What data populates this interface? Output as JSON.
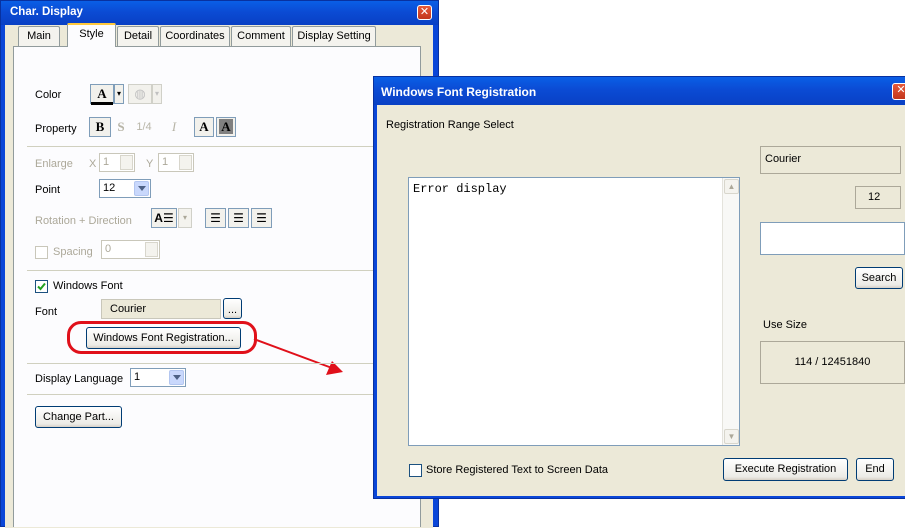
{
  "char_display": {
    "title": "Char. Display",
    "tabs": [
      "Main",
      "Style",
      "Detail",
      "Coordinates",
      "Comment",
      "Display Setting"
    ],
    "selected_tab": "Style",
    "color_label": "Color",
    "color_glyph": "A",
    "property_label": "Property",
    "property_buttons": [
      "B",
      "S",
      "1/4",
      "I",
      "A",
      "A"
    ],
    "enlarge_label": "Enlarge",
    "enlarge_x_label": "X",
    "enlarge_x_value": "1",
    "enlarge_y_label": "Y",
    "enlarge_y_value": "1",
    "point_label": "Point",
    "point_value": "12",
    "rotation_label": "Rotation + Direction",
    "spacing_label": "Spacing",
    "spacing_value": "0",
    "windows_font_label": "Windows Font",
    "windows_font_checked": true,
    "font_label": "Font",
    "font_value": "Courier",
    "browse_label": "...",
    "registration_button": "Windows Font Registration...",
    "display_language_label": "Display Language",
    "display_language_value": "1",
    "change_part_button": "Change Part..."
  },
  "font_registration": {
    "title": "Windows Font Registration",
    "range_label": "Registration Range Select",
    "text_content": "Error display",
    "font_name": "Courier",
    "font_size": "12",
    "search_input_value": "",
    "search_button": "Search",
    "use_size_label": "Use Size",
    "use_size_value": "114 / 12451840",
    "store_checkbox_label": "Store Registered Text to Screen Data",
    "store_checked": false,
    "execute_button": "Execute Registration",
    "end_button": "End"
  },
  "colors": {
    "title_bar": "#0a46d8",
    "highlight": "#e0101a",
    "dialog_bg": "#ece9d8"
  }
}
